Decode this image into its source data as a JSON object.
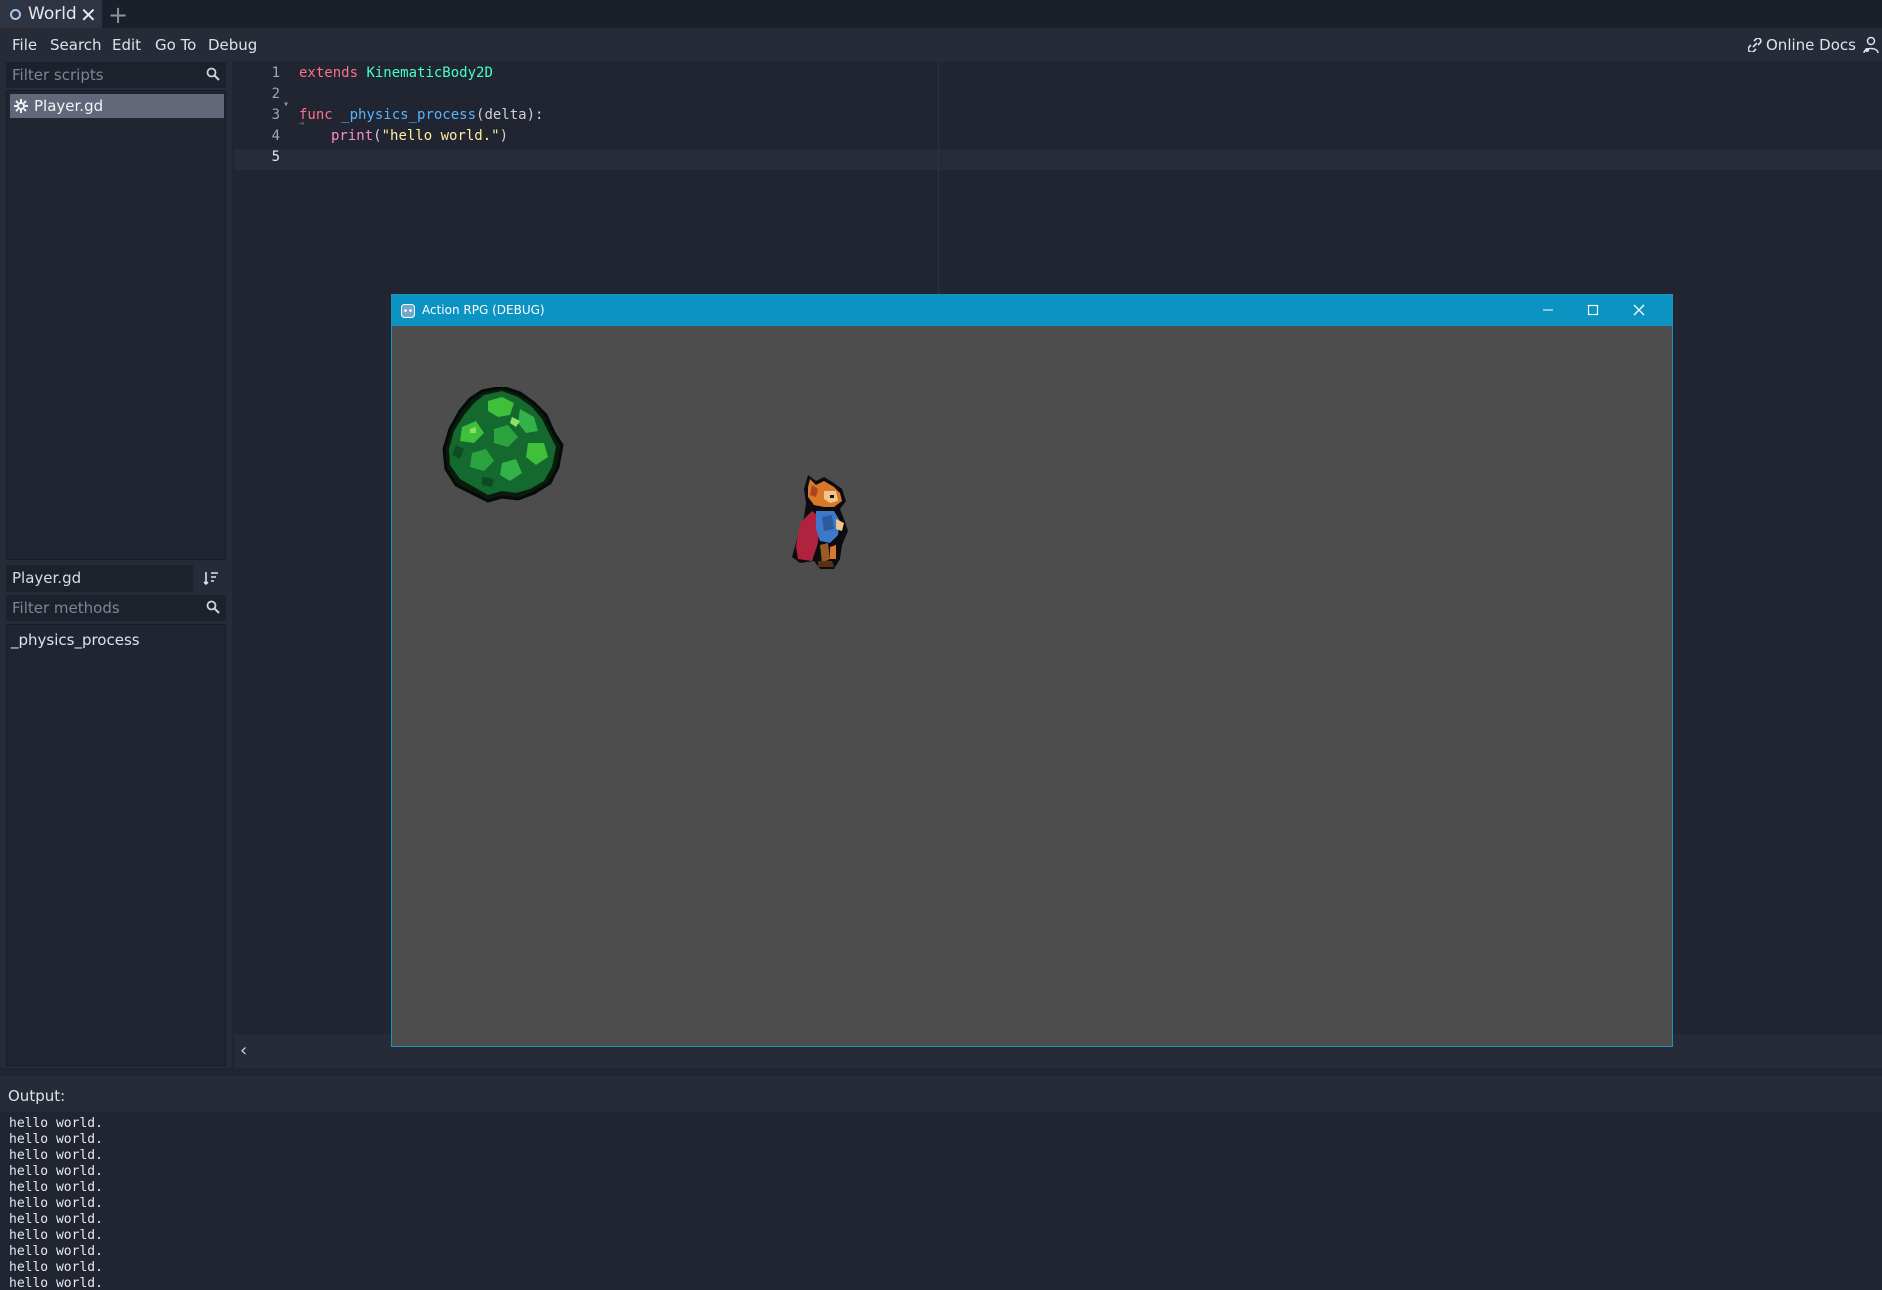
{
  "tabs": [
    {
      "label": "World",
      "active": true
    }
  ],
  "menu": [
    "File",
    "Search",
    "Edit",
    "Go To",
    "Debug"
  ],
  "online_docs": "Online Docs",
  "scripts": {
    "filter_placeholder": "Filter scripts",
    "items": [
      "Player.gd"
    ]
  },
  "methods": {
    "current_script": "Player.gd",
    "filter_placeholder": "Filter methods",
    "items": [
      "_physics_process"
    ]
  },
  "code": {
    "line_numbers": [
      "1",
      "2",
      "3",
      "4",
      "5"
    ],
    "line1": {
      "kw": "extends",
      "type": "KinematicBody2D"
    },
    "line3": {
      "kw": "func",
      "name": "_physics_process",
      "args": "(delta):"
    },
    "line4": {
      "call": "print",
      "open": "(",
      "string": "\"hello world.\"",
      "close": ")"
    }
  },
  "output": {
    "label": "Output:",
    "lines": [
      "hello world.",
      "hello world.",
      "hello world.",
      "hello world.",
      "hello world.",
      "hello world.",
      "hello world.",
      "hello world.",
      "hello world.",
      "hello world.",
      "hello world."
    ]
  },
  "game_window": {
    "title": "Action RPG (DEBUG)"
  },
  "colors": {
    "editor_bg": "#202531",
    "panel_bg": "#262b37",
    "titlebar": "#0b94c2",
    "keyword": "#ff7085",
    "type": "#42ffc2",
    "function": "#57b3ff",
    "string": "#ffeda1"
  }
}
